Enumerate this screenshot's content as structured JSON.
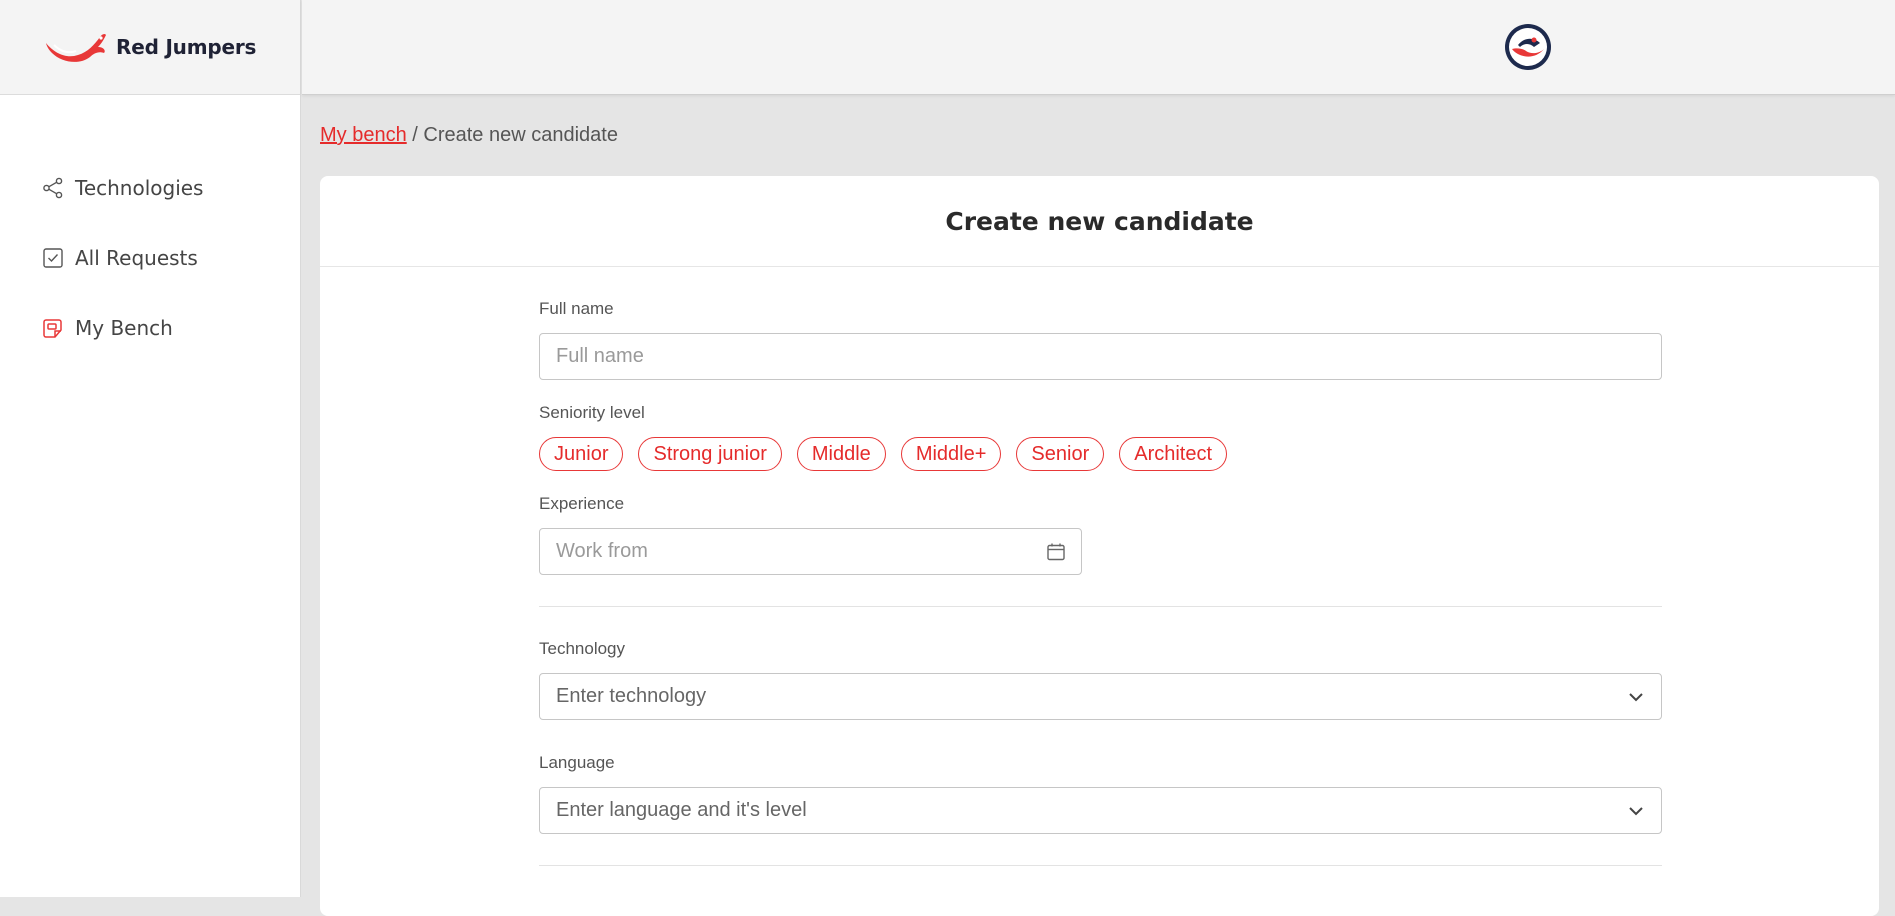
{
  "app": {
    "brand": "Red Jumpers"
  },
  "sidebar": {
    "items": [
      {
        "label": "Technologies",
        "icon": "share-icon"
      },
      {
        "label": "All Requests",
        "icon": "checkbox-icon"
      },
      {
        "label": "My Bench",
        "icon": "bench-icon"
      }
    ]
  },
  "breadcrumb": {
    "link": "My bench",
    "separator": " / ",
    "current": "Create new candidate"
  },
  "form": {
    "title": "Create new candidate",
    "full_name": {
      "label": "Full name",
      "placeholder": "Full name"
    },
    "seniority": {
      "label": "Seniority level",
      "options": [
        "Junior",
        "Strong junior",
        "Middle",
        "Middle+",
        "Senior",
        "Architect"
      ]
    },
    "experience": {
      "label": "Experience",
      "placeholder": "Work from"
    },
    "technology": {
      "label": "Technology",
      "placeholder": "Enter technology"
    },
    "language": {
      "label": "Language",
      "placeholder": "Enter language and it's level"
    }
  },
  "colors": {
    "accent": "#e52b2b",
    "brand_dark": "#1f2235",
    "annotation_arrow": "#e0201f"
  }
}
